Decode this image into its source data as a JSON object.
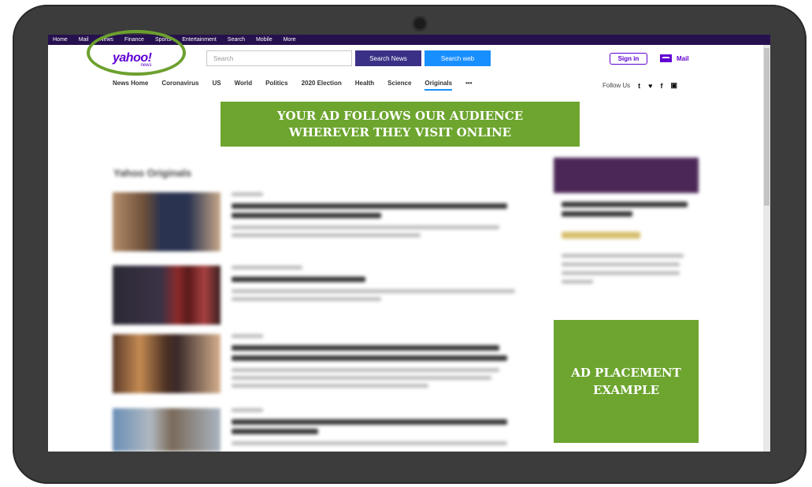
{
  "topnav": [
    "Home",
    "Mail",
    "News",
    "Finance",
    "Sports",
    "Entertainment",
    "Search",
    "Mobile",
    "More"
  ],
  "logo": {
    "brand": "yahoo!",
    "sub": "news"
  },
  "search": {
    "placeholder": "Search",
    "news_btn": "Search News",
    "web_btn": "Search web"
  },
  "account": {
    "signin": "Sign in",
    "mail": "Mail"
  },
  "subnav": [
    "News Home",
    "Coronavirus",
    "US",
    "World",
    "Politics",
    "2020 Election",
    "Health",
    "Science",
    "Originals",
    "•••"
  ],
  "follow": {
    "label": "Follow Us",
    "icons": [
      "t",
      "♥",
      "f",
      "▣"
    ]
  },
  "banner": {
    "line1": "YOUR AD FOLLOWS OUR AUDIENCE",
    "line2": "WHEREVER THEY VISIT ONLINE"
  },
  "section_title": "Yahoo Originals",
  "ad_placement": {
    "line1": "AD PLACEMENT",
    "line2": "EXAMPLE"
  },
  "colors": {
    "topnav_bg": "#26114f",
    "brand": "#6001d2",
    "ad_green": "#6da52f",
    "ring_green": "#6da02e"
  }
}
